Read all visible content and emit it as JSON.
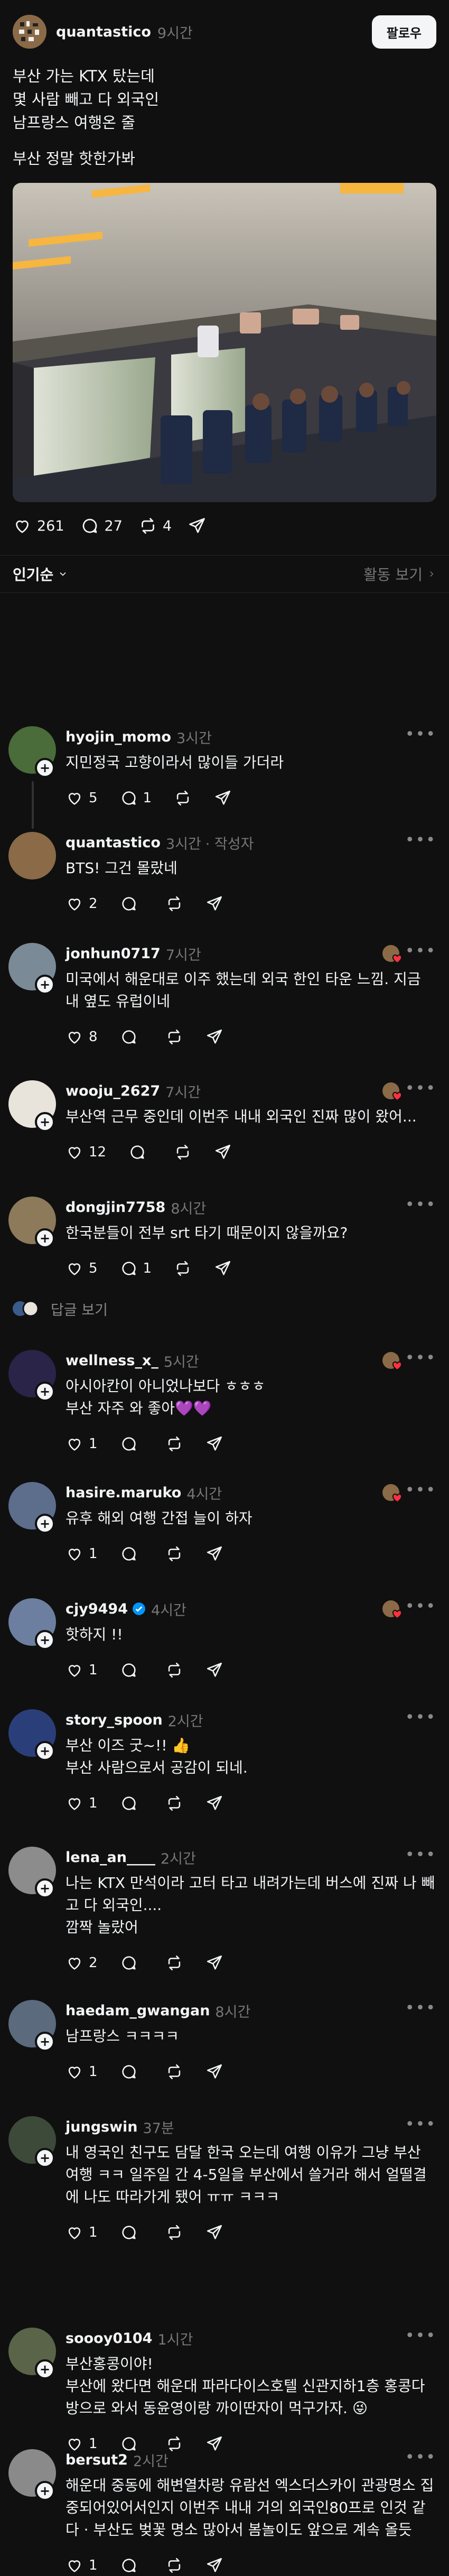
{
  "post": {
    "username": "quantastico",
    "time": "9시간",
    "follow_label": "팔로우",
    "paragraphs": [
      "부산 가는 KTX 탔는데\n몇 사람 빼고 다 외국인\n남프랑스 여행온 줄",
      "부산 정말 핫한가봐"
    ],
    "likes": "261",
    "comments": "27",
    "reposts": "4"
  },
  "sort": {
    "label": "인기순",
    "view_activity": "활동 보기"
  },
  "comments": [
    {
      "username": "hyojin_momo",
      "time": "3시간",
      "text": "지민정국 고향이라서 많이들 가더라",
      "likes": "5",
      "replies": "1"
    },
    {
      "username": "quantastico",
      "time": "3시간",
      "author_badge": "· 작성자",
      "text": "BTS! 그건 몰랐네",
      "likes": "2",
      "replies": ""
    },
    {
      "username": "jonhun0717",
      "time": "7시간",
      "text": "미국에서 해운대로 이주 했는데 외국 한인 타운 느낌. 지금 내 옆도 유럽이네",
      "likes": "8",
      "replies": ""
    },
    {
      "username": "wooju_2627",
      "time": "7시간",
      "text": "부산역 근무 중인데 이번주 내내 외국인 진짜 많이 왔어...",
      "likes": "12",
      "replies": ""
    },
    {
      "username": "dongjin7758",
      "time": "8시간",
      "text": "한국분들이 전부 srt 타기 때문이지 않을까요?",
      "likes": "5",
      "replies": "1",
      "view_replies": "답글 보기"
    },
    {
      "username": "wellness_x_",
      "time": "5시간",
      "text": "아시아칸이 아니었나보다 ㅎㅎㅎ\n부산 자주 와 좋아💜💜",
      "likes": "1",
      "replies": ""
    },
    {
      "username": "hasire.maruko",
      "time": "4시간",
      "text": "유후 해외 여행 간접 늘이 하자",
      "likes": "1",
      "replies": ""
    },
    {
      "username": "cjy9494",
      "time": "4시간",
      "text": "핫하지 !!",
      "likes": "1",
      "replies": ""
    },
    {
      "username": "story_spoon",
      "time": "2시간",
      "text": "부산 이즈 굿~!! 👍\n부산 사람으로서 공감이 되네.",
      "likes": "1",
      "replies": ""
    },
    {
      "username": "lena_an____",
      "time": "2시간",
      "text": "나는 KTX 만석이라 고터 타고 내려가는데 버스에 진짜 나 빼고 다 외국인....\n깜짝 놀랐어",
      "likes": "2",
      "replies": ""
    },
    {
      "username": "haedam_gwangan",
      "time": "8시간",
      "text": "남프랑스 ㅋㅋㅋㅋ",
      "likes": "1",
      "replies": ""
    },
    {
      "username": "jungswin",
      "time": "37분",
      "text": "내 영국인 친구도 담달 한국 오는데 여행 이유가 그냥 부산 여행 ㅋㅋ 일주일 간 4-5일을 부산에서 쓸거라  해서 얼떨결에 나도 따라가게 됐어 ㅠㅠ ㅋㅋㅋ",
      "likes": "1",
      "replies": ""
    },
    {
      "username": "soooy0104",
      "time": "1시간",
      "text": "부산홍콩이야!\n부산에 왔다면 해운대 파라다이스호텔 신관지하1층 홍콩다방으로 와서 동윤영이랑 까이딴자이 먹구가자. 😜",
      "likes": "1",
      "replies": ""
    },
    {
      "username": "bersut2",
      "time": "2시간",
      "text": "해운대 중동에 해변열차랑 유람선 엑스더스카이 관광명소 집중되어있어서인지 이번주 내내 거의 외국인80프로 인것 같다 · 부산도 벚꽃 명소 많아서 봄놀이도 앞으로 계속 올듯",
      "likes": "1",
      "replies": ""
    }
  ],
  "colors": {
    "background": "#101010",
    "text": "#f3f5f7",
    "muted": "#777777",
    "verified": "#0095f6"
  }
}
